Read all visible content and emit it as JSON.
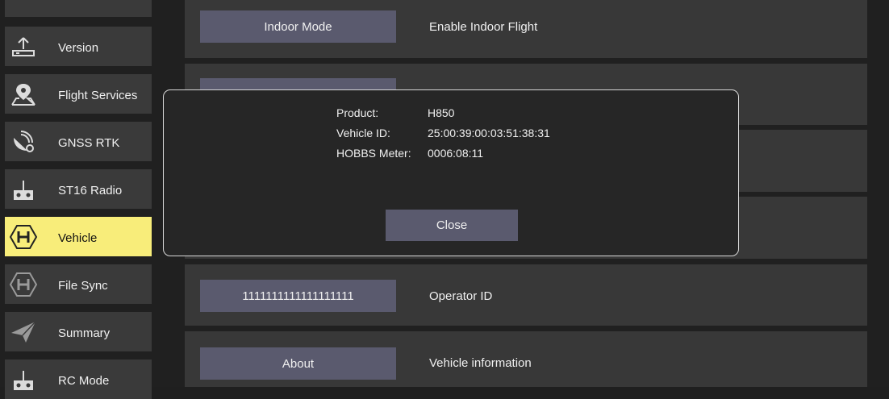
{
  "sidebar": {
    "items": [
      {
        "label": "Version",
        "icon": "upload-icon"
      },
      {
        "label": "Flight Services",
        "icon": "map-pin-icon"
      },
      {
        "label": "GNSS RTK",
        "icon": "satellite-gear-icon"
      },
      {
        "label": "ST16 Radio",
        "icon": "radio-controller-icon"
      },
      {
        "label": "Vehicle",
        "icon": "h-hexagon-icon",
        "active": true
      },
      {
        "label": "File Sync",
        "icon": "h-hexagon-icon"
      },
      {
        "label": "Summary",
        "icon": "paper-plane-icon"
      },
      {
        "label": "RC Mode",
        "icon": "radio-controller-icon"
      }
    ]
  },
  "main": {
    "indoor": {
      "button": "Indoor Mode",
      "desc": "Enable Indoor Flight"
    },
    "operator": {
      "button": "1111111111111111111",
      "desc": "Operator ID"
    },
    "about": {
      "button": "About",
      "desc": "Vehicle information"
    }
  },
  "dialog": {
    "product_label": "Product:",
    "product_value": "H850",
    "vehicle_id_label": "Vehicle ID:",
    "vehicle_id_value": "25:00:39:00:03:51:38:31",
    "hobbs_label": "HOBBS Meter:",
    "hobbs_value": "0006:08:11",
    "close_label": "Close"
  },
  "colors": {
    "active_item": "#f8ed7a",
    "button": "#5a5a6e",
    "panel": "#383838",
    "background": "#202020"
  }
}
